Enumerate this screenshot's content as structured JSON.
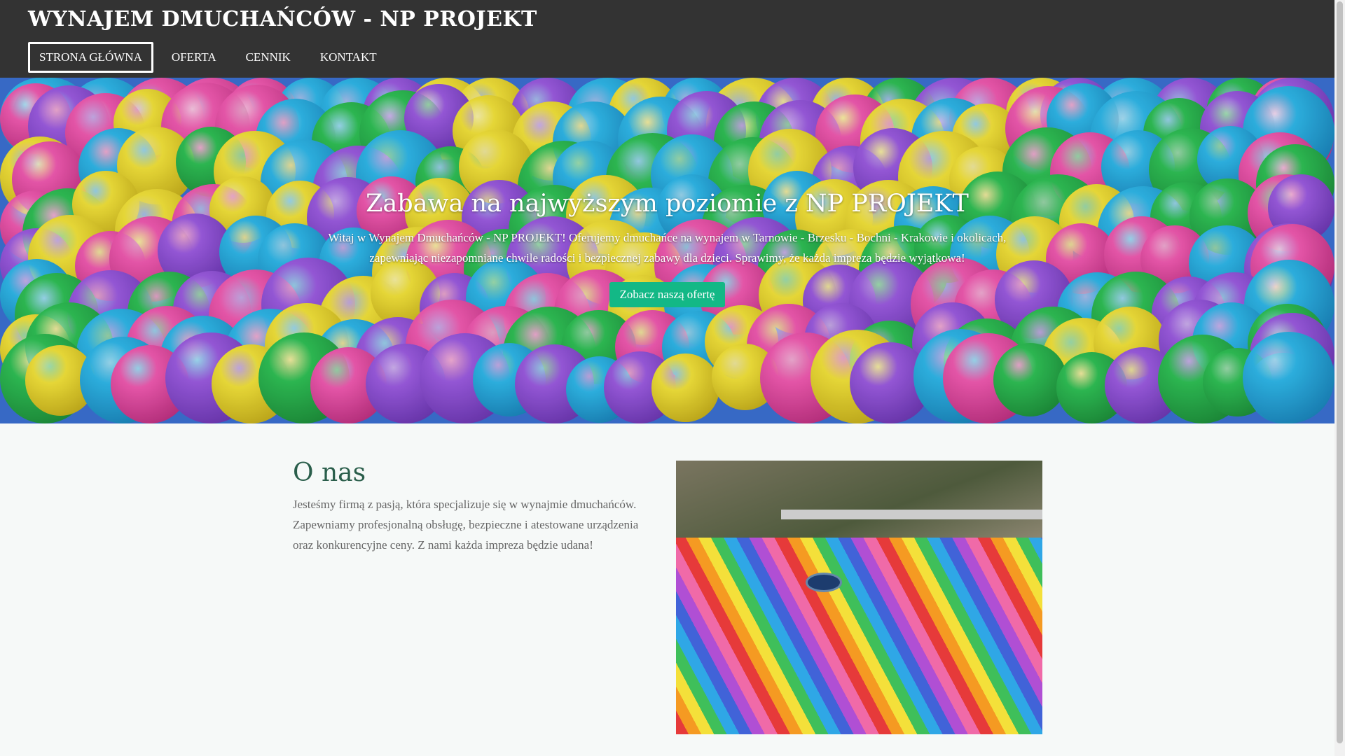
{
  "header": {
    "title": "WYNAJEM DMUCHAŃCÓW - NP PROJEKT",
    "nav": [
      {
        "label": "STRONA GŁÓWNA",
        "active": true
      },
      {
        "label": "OFERTA"
      },
      {
        "label": "CENNIK"
      },
      {
        "label": "KONTAKT"
      }
    ]
  },
  "hero": {
    "heading": "Zabawa na najwyższym poziomie z NP PROJEKT",
    "text": "Witaj w Wynajem Dmuchańców - NP PROJEKT! Oferujemy dmuchańce na wynajem w Tarnowie - Brzesku - Bochni - Krakowie i okolicach, zapewniając niezapomniane chwile radości i bezpiecznej zabawy dla dzieci. Sprawimy, że każda impreza będzie wyjątkowa!",
    "button": "Zobacz naszą ofertę",
    "button_color": "#13b886"
  },
  "about": {
    "heading": "O nas",
    "text": "Jesteśmy firmą z pasją, która specjalizuje się w wynajmie dmuchańców. Zapewniamy profesjonalną obsługę, bezpieczne i atestowane urządzenia oraz konkurencyjne ceny. Z nami każda impreza będzie udana!"
  },
  "colors": {
    "header_bg": "#333333",
    "accent": "#13b886",
    "about_heading": "#2a5e4b"
  }
}
